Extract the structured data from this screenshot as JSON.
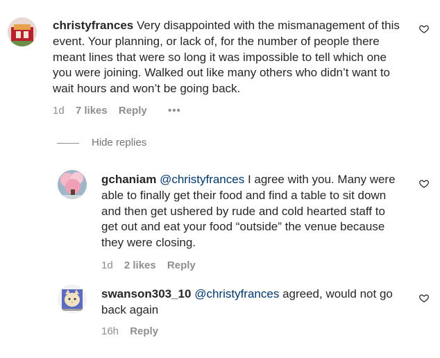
{
  "comments": [
    {
      "username": "christyfrances",
      "text": "Very disappointed with the mismanagement of this event. Your planning, or lack of, for the number of people there meant lines that were so long it was impossible to tell which one you were joining. Walked out like many others who didn’t want to wait hours and won’t be going back.",
      "time": "1d",
      "likes": "7 likes",
      "reply_label": "Reply",
      "more_label": "•••"
    }
  ],
  "hide_replies_label": "Hide replies",
  "replies": [
    {
      "username": "gchaniam",
      "mention": "@christyfrances",
      "text": "I agree with you. Many were able to finally get their food and find a table to sit down and then get ushered by rude and cold hearted staff to get out and eat your food “outside” the venue because they were closing.",
      "time": "1d",
      "likes": "2 likes",
      "reply_label": "Reply"
    },
    {
      "username": "swanson303_10",
      "mention": "@christyfrances",
      "text": "agreed, would not go back again",
      "time": "16h",
      "reply_label": "Reply"
    }
  ],
  "icons": {
    "like": "heart-outline-icon",
    "avatar_christy": "avatar-photo",
    "avatar_gchaniam": "avatar-photo",
    "avatar_swanson": "avatar-photo"
  }
}
